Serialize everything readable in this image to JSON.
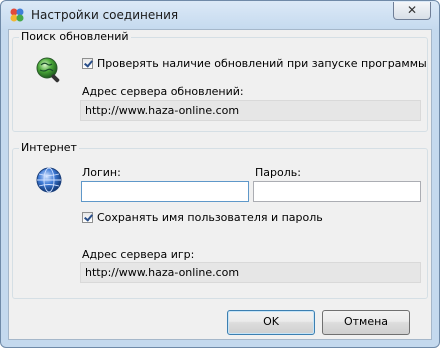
{
  "window": {
    "title": "Настройки соединения",
    "close_glyph": "✕"
  },
  "updates": {
    "group_title": "Поиск обновлений",
    "check_label": "Проверять наличие обновлений при запуске программы",
    "server_label": "Адрес сервера обновлений:",
    "server_value": "http://www.haza-online.com",
    "icon": "globe-search-icon"
  },
  "internet": {
    "group_title": "Интернет",
    "login_label": "Логин:",
    "login_value": "",
    "password_label": "Пароль:",
    "password_value": "",
    "save_label": "Сохранять имя пользователя и пароль",
    "game_server_label": "Адрес сервера игр:",
    "game_server_value": "http://www.haza-online.com",
    "icon": "globe-icon"
  },
  "buttons": {
    "ok": "OK",
    "cancel": "Отмена"
  }
}
